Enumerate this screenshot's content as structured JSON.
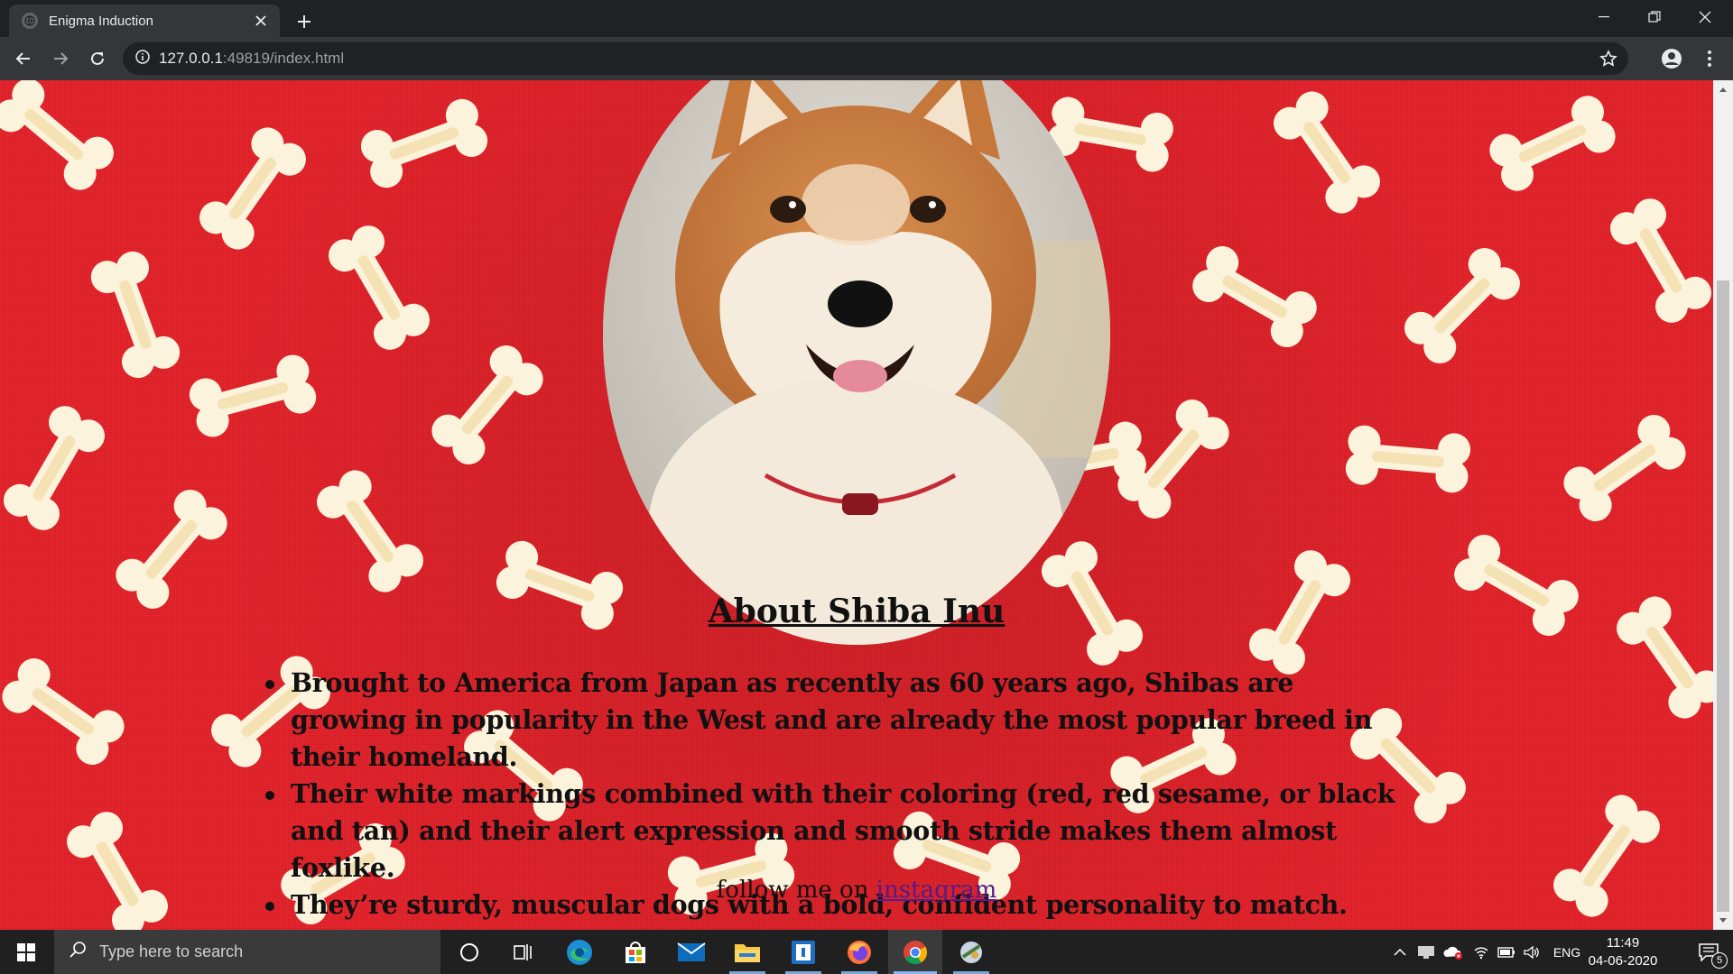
{
  "browser": {
    "tab_title": "Enigma Induction",
    "url_host": "127.0.0.1",
    "url_rest": ":49819/index.html"
  },
  "page": {
    "heading": "About Shiba Inu",
    "facts": [
      "Brought to America from Japan as recently as 60 years ago, Shibas are growing in popularity in the West and are already the most popular breed in their homeland.",
      "Their white markings combined with their coloring (red, red sesame, or black and tan) and their alert expression and smooth stride makes them almost foxlike.",
      "They’re sturdy, muscular dogs with a bold, confident personality to match."
    ],
    "follow_prefix": "follow me on ",
    "follow_link": "instagram",
    "background_color": "#e51d25"
  },
  "taskbar": {
    "search_placeholder": "Type here to search",
    "apps": [
      "cortana-icon",
      "task-view-icon",
      "edge-icon",
      "store-icon",
      "mail-icon",
      "file-explorer-icon",
      "app-icon",
      "firefox-icon",
      "chrome-icon",
      "pinball-icon"
    ],
    "language": "ENG",
    "time": "11:49",
    "date": "04-06-2020",
    "notification_count": "5"
  }
}
